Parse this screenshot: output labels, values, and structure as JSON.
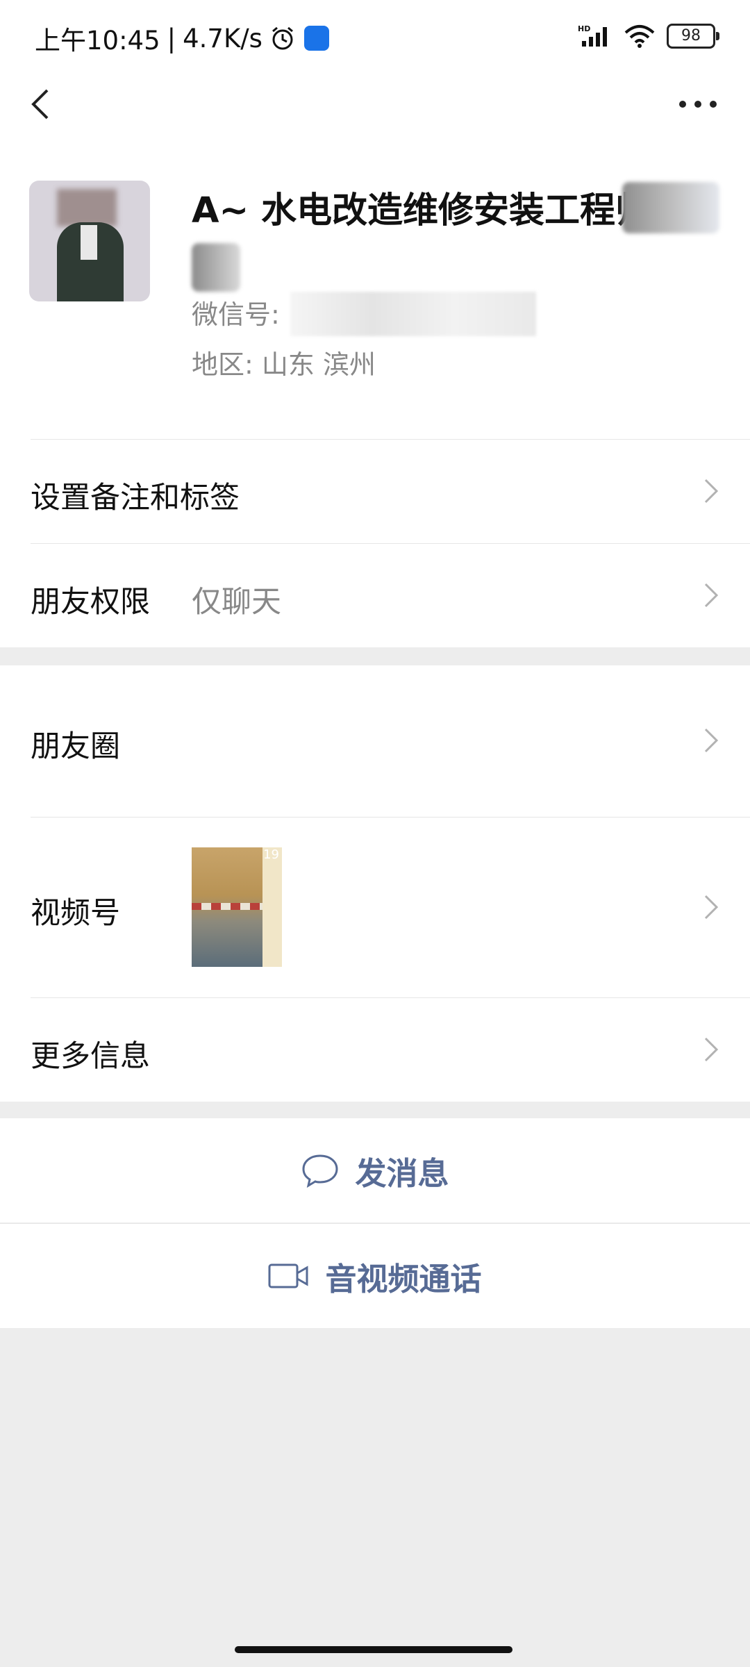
{
  "status_bar": {
    "time": "上午10:45",
    "net_speed": "4.7K/s",
    "network": "HD",
    "battery": "98"
  },
  "nav": {
    "back_icon": "chevron-left-icon",
    "more_icon": "more-dots-icon"
  },
  "profile": {
    "name": "A~ 水电改造维修安装工程师",
    "wechat_id_label": "微信号:",
    "region": "地区:  山东  滨州"
  },
  "rows": {
    "remark": {
      "label": "设置备注和标签"
    },
    "permission": {
      "label": "朋友权限",
      "value": "仅聊天"
    },
    "moments": {
      "label": "朋友圈"
    },
    "channels": {
      "label": "视频号",
      "thumb_count": "19"
    },
    "more_info": {
      "label": "更多信息"
    }
  },
  "actions": {
    "message": "发消息",
    "call": "音视频通话"
  },
  "colors": {
    "link_blue": "#576b95",
    "background": "#ededed"
  }
}
